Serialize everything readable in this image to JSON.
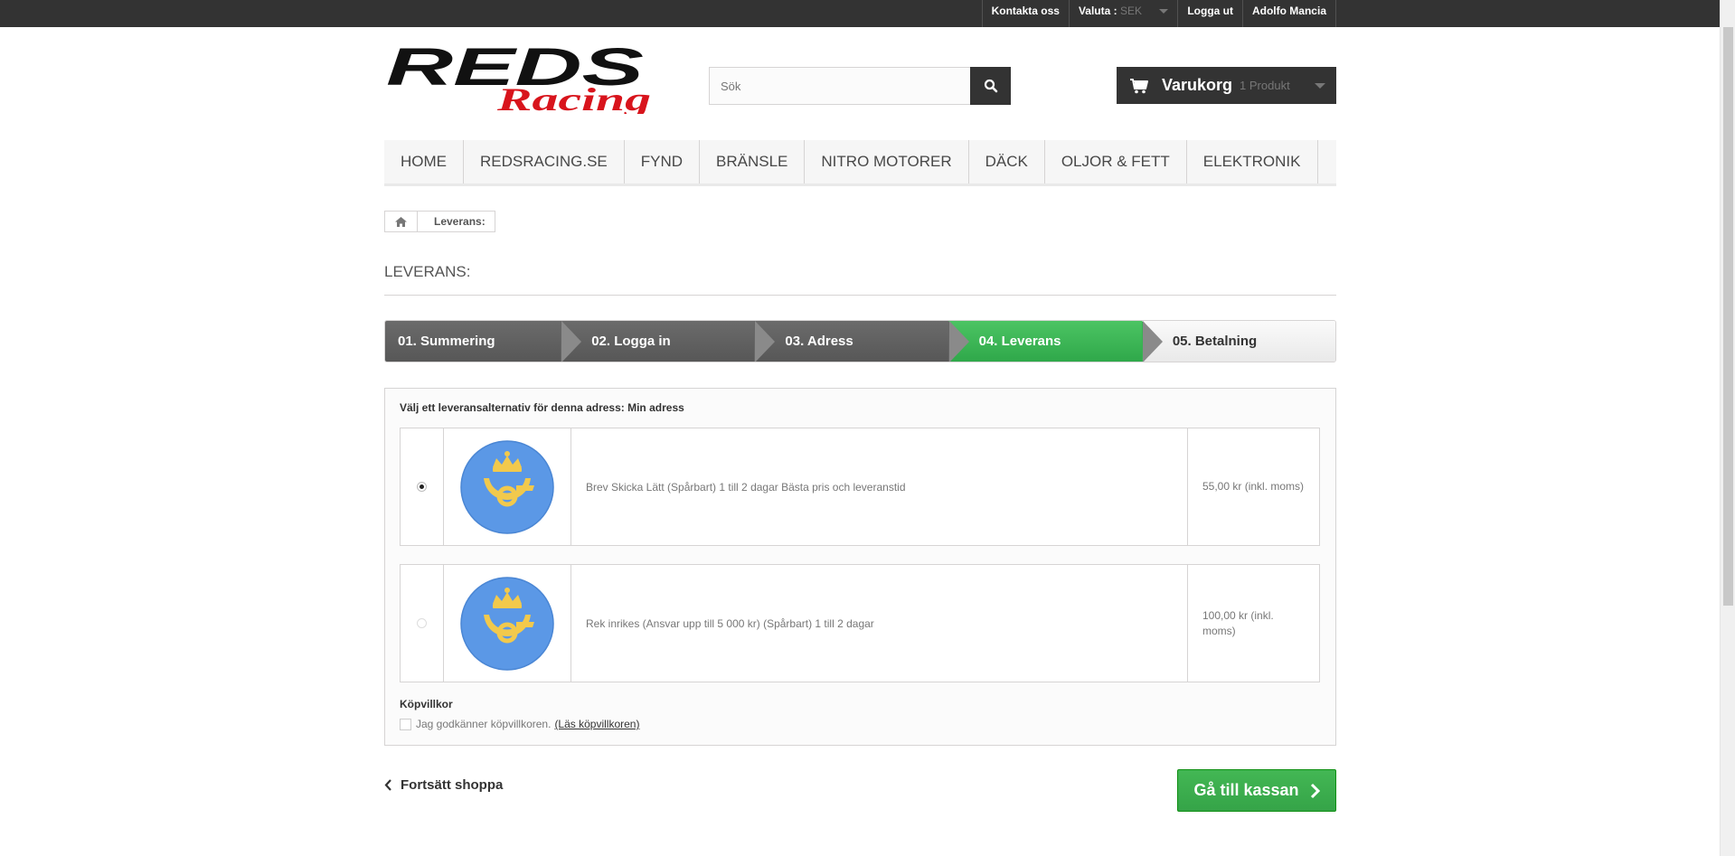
{
  "topbar": {
    "contact": "Kontakta oss",
    "currency_label": "Valuta :",
    "currency_value": "SEK",
    "logout": "Logga ut",
    "user": "Adolfo Mancia"
  },
  "logo": {
    "line1": "REDS",
    "line2": "Racing"
  },
  "search": {
    "placeholder": "Sök"
  },
  "cart": {
    "label": "Varukorg",
    "qty": "1 Produkt"
  },
  "menu": [
    "HOME",
    "REDSRACING.SE",
    "FYND",
    "BRÄNSLE",
    "NITRO MOTORER",
    "DÄCK",
    "OLJOR & FETT",
    "ELEKTRONIK"
  ],
  "breadcrumb": {
    "current": "Leverans:"
  },
  "page_heading": "LEVERANS:",
  "steps": [
    "01. Summering",
    "02. Logga in",
    "03. Adress",
    "04. Leverans",
    "05. Betalning"
  ],
  "delivery": {
    "intro": "Välj ett leveransalternativ för denna adress: Min adress",
    "options": [
      {
        "description": "Brev Skicka Lätt (Spårbart) 1 till 2 dagar Bästa pris och leveranstid",
        "price": "55,00 kr (inkl. moms)",
        "selected": true
      },
      {
        "description": "Rek inrikes (Ansvar upp till 5 000 kr) (Spårbart) 1 till 2 dagar",
        "price": "100,00 kr (inkl. moms)",
        "selected": false
      }
    ],
    "terms_title": "Köpvillkor",
    "terms_text": "Jag godkänner köpvillkoren.",
    "terms_link": "(Läs köpvillkoren)"
  },
  "continue_shopping": "Fortsätt shoppa",
  "checkout": "Gå till kassan",
  "colors": {
    "accent_green": "#35a448",
    "dark": "#333333",
    "logo_red": "#d8141c",
    "postnord_blue": "#5b98e6",
    "postnord_yellow": "#f2c94c"
  }
}
